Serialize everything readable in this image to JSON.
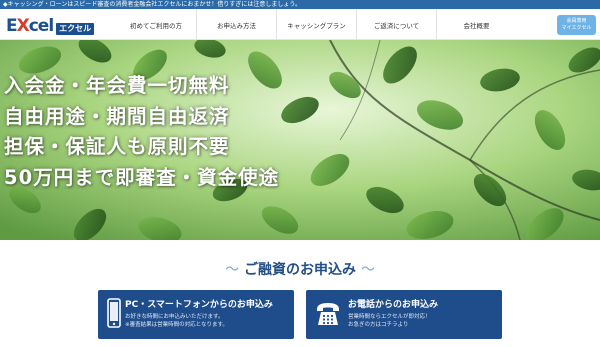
{
  "topbar": {
    "notice": "◆キャッシング・ローンはスピード審査の消費者金融会社エクセルにおまかせ！借りすぎには注意しましょう。"
  },
  "header": {
    "logo_main_1": "E",
    "logo_main_x": "X",
    "logo_main_2": "cel",
    "logo_kana": "エクセル",
    "nav": [
      "初めてご利用の方",
      "お申込み方法",
      "キャッシングプラン",
      "ご返済について",
      "会社概要"
    ],
    "member_button_line1": "会員専用",
    "member_button_line2": "マイエクセル"
  },
  "hero": {
    "lines": [
      "入会金・年会費一切無料",
      "自由用途・期間自由返済",
      "担保・保証人も原則不要",
      "50万円まで即審査・資金使途"
    ]
  },
  "application": {
    "title": "ご融資のお申込み",
    "title_deco": "～",
    "pc": {
      "title": "PC・スマートフォンからのお申込み",
      "sub1": "お好きな時間にお申込みいただけます。",
      "sub2": "※審査結果は営業時間の対応となります。",
      "icon": "smartphone-icon"
    },
    "tel": {
      "title": "お電話からのお申込み",
      "sub1": "営業時間ならエクセルが即対応！",
      "sub2": "お急ぎの方はコチラより",
      "icon": "telephone-icon"
    }
  },
  "colors": {
    "topbar": "#2b6aa6",
    "brand_navy": "#1f4d8c",
    "accent_blue": "#6fb3e6",
    "title_blue": "#234e86"
  }
}
